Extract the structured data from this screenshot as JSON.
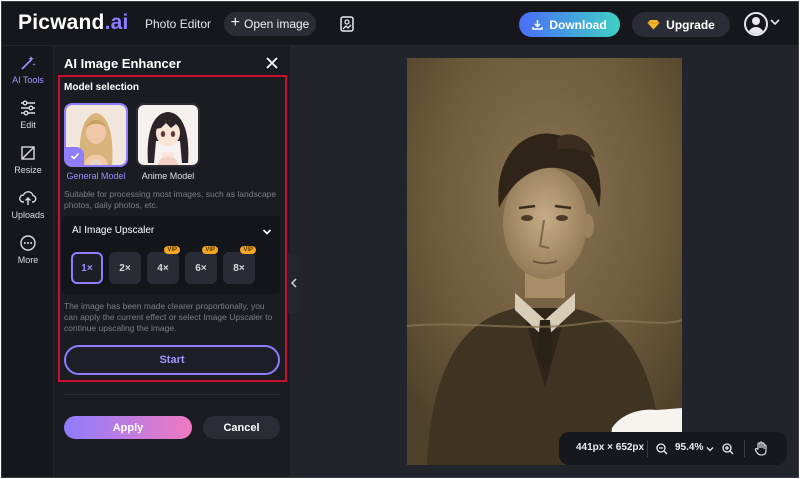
{
  "header": {
    "logo_main": "Picwand",
    "logo_dot": ".ai",
    "nav_photo_editor": "Photo Editor",
    "open_image_label": "Open image",
    "download_label": "Download",
    "upgrade_label": "Upgrade"
  },
  "sidebar": {
    "items": [
      {
        "label": "AI Tools",
        "icon": "ai-tools-icon",
        "active": true
      },
      {
        "label": "Edit",
        "icon": "sliders-icon"
      },
      {
        "label": "Resize",
        "icon": "resize-icon"
      },
      {
        "label": "Uploads",
        "icon": "upload-icon"
      },
      {
        "label": "More",
        "icon": "more-icon"
      }
    ]
  },
  "panel": {
    "title": "AI Image Enhancer",
    "model_selection_label": "Model selection",
    "models": [
      {
        "label": "General Model",
        "selected": true
      },
      {
        "label": "Anime Model",
        "selected": false
      }
    ],
    "model_description": "Suitable for processing most images, such as landscape photos, daily photos, etc.",
    "upscaler_title": "AI Image Upscaler",
    "scales": [
      {
        "label": "1×",
        "vip": false,
        "active": true
      },
      {
        "label": "2×",
        "vip": false,
        "active": false
      },
      {
        "label": "4×",
        "vip": true,
        "active": false
      },
      {
        "label": "6×",
        "vip": true,
        "active": false
      },
      {
        "label": "8×",
        "vip": true,
        "active": false
      }
    ],
    "vip_badge": "VIP",
    "note": "The image has been made clearer proportionally, you can apply the current effect or select Image Upscaler to continue upscaling the image.",
    "start_label": "Start",
    "apply_label": "Apply",
    "cancel_label": "Cancel"
  },
  "canvas": {
    "dimensions": "441px × 652px",
    "zoom": "95.4%"
  },
  "colors": {
    "accent": "#8f7cff",
    "highlight_box": "#c8102e",
    "download_gradient": [
      "#4a6cf7",
      "#3fd1c4"
    ],
    "apply_gradient": [
      "#8f7cff",
      "#f07ac0"
    ]
  }
}
